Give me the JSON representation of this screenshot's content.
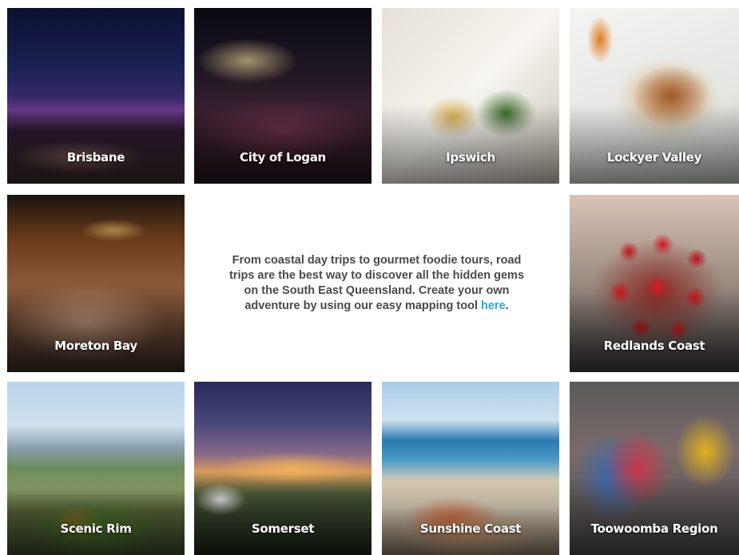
{
  "intro": {
    "text": "From coastal day trips to gourmet foodie tours, road trips are the best way to discover all the hidden gems on the South East Queensland. Create your own adventure by using our easy mapping tool ",
    "link_label": "here",
    "trailing": ".",
    "link_color": "#2aa6d6"
  },
  "tiles": [
    {
      "label": "Brisbane"
    },
    {
      "label": "City of Logan"
    },
    {
      "label": "Ipswich"
    },
    {
      "label": "Lockyer Valley"
    },
    {
      "label": "Moreton Bay"
    },
    {
      "label": "Redlands Coast"
    },
    {
      "label": "Scenic Rim"
    },
    {
      "label": "Somerset"
    },
    {
      "label": "Sunshine Coast"
    },
    {
      "label": "Toowoomba Region"
    }
  ]
}
